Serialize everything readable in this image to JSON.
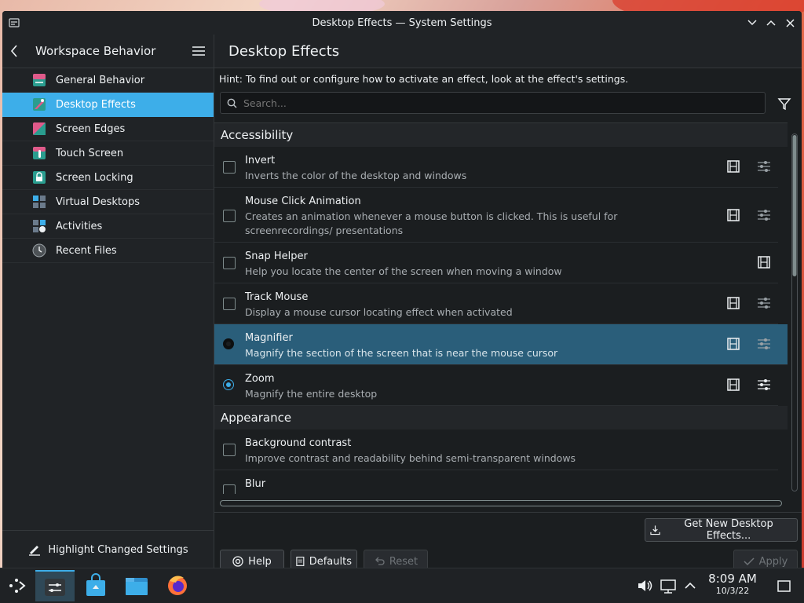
{
  "window": {
    "title": "Desktop Effects — System Settings"
  },
  "sidebar": {
    "header": "Workspace Behavior",
    "items": [
      {
        "label": "General Behavior",
        "icon": "general-behavior-icon",
        "color": "#2a9d8f"
      },
      {
        "label": "Desktop Effects",
        "icon": "desktop-effects-icon",
        "color": "#e05a8a"
      },
      {
        "label": "Screen Edges",
        "icon": "screen-edges-icon",
        "color": "#e05a8a"
      },
      {
        "label": "Touch Screen",
        "icon": "touch-screen-icon",
        "color": "#2a9d8f"
      },
      {
        "label": "Screen Locking",
        "icon": "screen-locking-icon",
        "color": "#2a9d8f"
      },
      {
        "label": "Virtual Desktops",
        "icon": "virtual-desktops-icon",
        "color": "#6b7b8c"
      },
      {
        "label": "Activities",
        "icon": "activities-icon",
        "color": "#6b7b8c"
      },
      {
        "label": "Recent Files",
        "icon": "recent-files-icon",
        "color": "#6b7b8c"
      }
    ],
    "selected": "Desktop Effects",
    "footer": "Highlight Changed Settings"
  },
  "main": {
    "title": "Desktop Effects",
    "hint": "Hint: To find out or configure how to activate an effect, look at the effect's settings.",
    "search_placeholder": "Search...",
    "categories": [
      {
        "name": "Accessibility",
        "effects": [
          {
            "title": "Invert",
            "desc": "Inverts the color of the desktop and windows",
            "control": "checkbox",
            "checked": false,
            "configurable": true
          },
          {
            "title": "Mouse Click Animation",
            "desc": "Creates an animation whenever a mouse button is clicked. This is useful for screenrecordings/ presentations",
            "control": "checkbox",
            "checked": false,
            "configurable": true
          },
          {
            "title": "Snap Helper",
            "desc": "Help you locate the center of the screen when moving a window",
            "control": "checkbox",
            "checked": false,
            "configurable": false
          },
          {
            "title": "Track Mouse",
            "desc": "Display a mouse cursor locating effect when activated",
            "control": "checkbox",
            "checked": false,
            "configurable": true
          },
          {
            "title": "Magnifier",
            "desc": "Magnify the section of the screen that is near the mouse cursor",
            "control": "radio",
            "checked": false,
            "configurable": true,
            "selected": true
          },
          {
            "title": "Zoom",
            "desc": "Magnify the entire desktop",
            "control": "radio",
            "checked": true,
            "configurable": true
          }
        ]
      },
      {
        "name": "Appearance",
        "effects": [
          {
            "title": "Background contrast",
            "desc": "Improve contrast and readability behind semi-transparent windows",
            "control": "checkbox",
            "checked": false,
            "configurable": false
          },
          {
            "title": "Blur",
            "desc": "",
            "control": "checkbox",
            "checked": false,
            "configurable": true
          }
        ]
      }
    ],
    "buttons": {
      "get_new": "Get New Desktop Effects...",
      "help": "Help",
      "defaults": "Defaults",
      "reset": "Reset",
      "apply": "Apply"
    }
  },
  "taskbar": {
    "time": "8:09 AM",
    "date": "10/3/22"
  },
  "colors": {
    "accent": "#3daee9",
    "selected_row": "#2a5e7a",
    "window_bg": "#1b1e20"
  }
}
